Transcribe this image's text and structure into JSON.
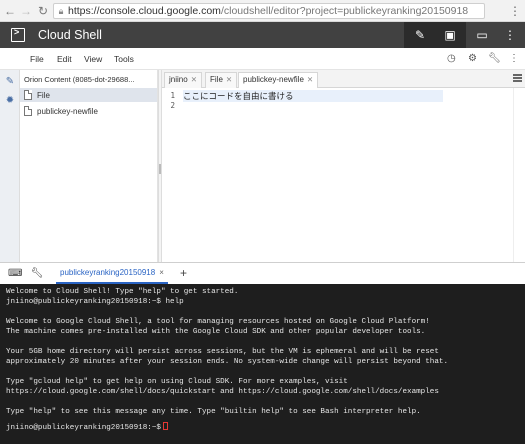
{
  "browser": {
    "url_host": "https://console.cloud.google.com",
    "url_path": "/cloudshell/editor?project=publickeyranking20150918"
  },
  "appbar": {
    "title": "Cloud Shell",
    "buttons": [
      "edit-icon",
      "terminal-icon",
      "cast-icon",
      "more-icon"
    ]
  },
  "editor_menu": {
    "items": [
      "File",
      "Edit",
      "View",
      "Tools"
    ]
  },
  "file_tree": {
    "root": "Orion Content (8085-dot-29688...",
    "items": [
      {
        "label": "File",
        "selected": true
      },
      {
        "label": "publickey-newfile",
        "selected": false
      }
    ]
  },
  "editor": {
    "tabs": [
      {
        "label": "jniino",
        "active": false
      },
      {
        "label": "File",
        "active": false
      },
      {
        "label": "publickey-newfile",
        "active": true
      }
    ],
    "line_numbers": [
      "1",
      "2"
    ],
    "lines": [
      "ここにコードを自由に書ける",
      ""
    ]
  },
  "terminal_toolbar": {
    "tab_label": "publickeyranking20150918",
    "close_label": "×",
    "add_label": "+"
  },
  "terminal": {
    "lines": [
      "Welcome to Cloud Shell! Type \"help\" to get started.",
      "jniino@publickeyranking20150918:~$ help",
      "",
      "Welcome to Google Cloud Shell, a tool for managing resources hosted on Google Cloud Platform!",
      "The machine comes pre-installed with the Google Cloud SDK and other popular developer tools.",
      "",
      "Your 5GB home directory will persist across sessions, but the VM is ephemeral and will be reset",
      "approximately 20 minutes after your session ends. No system-wide change will persist beyond that.",
      "",
      "Type \"gcloud help\" to get help on using Cloud SDK. For more examples, visit",
      "https://cloud.google.com/shell/docs/quickstart and https://cloud.google.com/shell/docs/examples",
      "",
      "Type \"help\" to see this message any time. Type \"builtin help\" to see Bash interpreter help.",
      ""
    ],
    "prompt": "jniino@publickeyranking20150918:~$"
  }
}
